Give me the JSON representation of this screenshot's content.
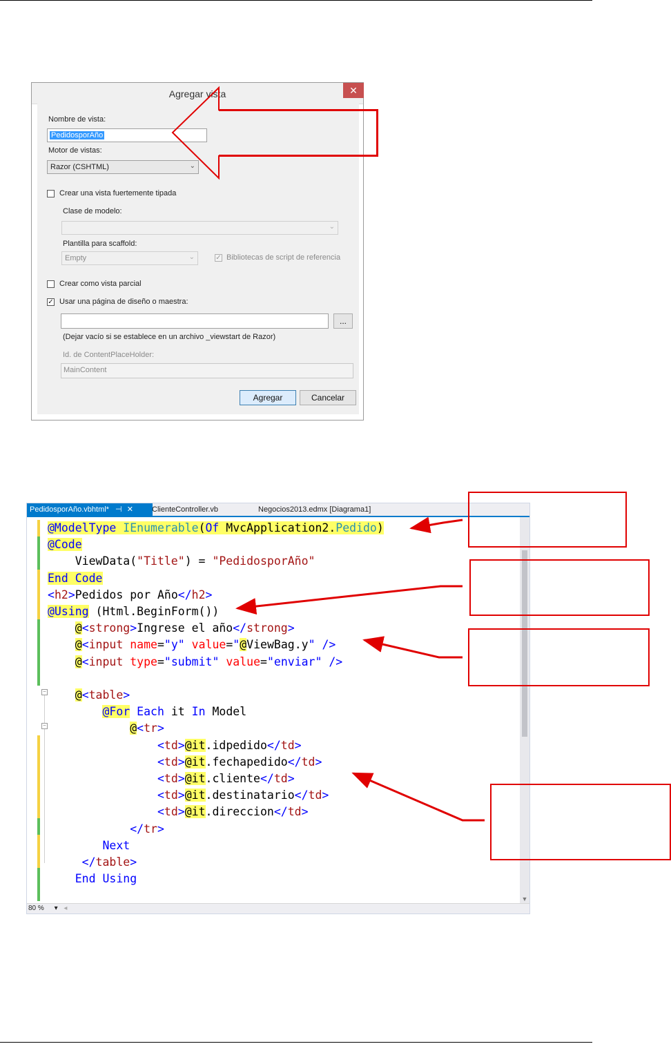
{
  "dialog": {
    "title": "Agregar vista",
    "close_glyph": "✕",
    "view_name_label": "Nombre de vista:",
    "view_name_value": "PedidosporAño",
    "engine_label": "Motor de vistas:",
    "engine_value": "Razor (CSHTML)",
    "strong_typed": {
      "label": "Crear una vista fuertemente tipada",
      "checked": false
    },
    "model_class_label": "Clase de modelo:",
    "model_class_value": "",
    "scaffold_label": "Plantilla para scaffold:",
    "scaffold_value": "Empty",
    "script_libs": {
      "label": "Bibliotecas de script de referencia",
      "checked": true,
      "check_glyph": "✓"
    },
    "partial_view": {
      "label": "Crear como vista parcial",
      "checked": false
    },
    "layout_page": {
      "label": "Usar una página de diseño o maestra:",
      "checked": true,
      "check_glyph": "✓"
    },
    "layout_path_value": "",
    "browse_label": "...",
    "layout_hint": "(Dejar vacío si se establece en un archivo _viewstart de Razor)",
    "placeholder_id_label": "Id. de ContentPlaceHolder:",
    "placeholder_id_value": "MainContent",
    "add_button": "Agregar",
    "cancel_button": "Cancelar"
  },
  "editor": {
    "tabs": [
      {
        "label": "PedidosporAño.vbhtml*",
        "pin": "⊣",
        "close": "✕",
        "active": true
      },
      {
        "label": "ClienteController.vb",
        "active": false
      },
      {
        "label": "Negocios2013.edmx [Diagrama1]",
        "active": false
      }
    ],
    "zoom": "80 %",
    "code_lines": [
      "@ModelType IEnumerable(Of MvcApplication2.Pedido)",
      "@Code",
      "    ViewData(\"Title\") = \"PedidosporAño\"",
      "End Code",
      "<h2>Pedidos por Año</h2>",
      "@Using (Html.BeginForm())",
      "    @<strong>Ingrese el año</strong>",
      "    @<input name=\"y\" value=\"@ViewBag.y\" />",
      "    @<input type=\"submit\" value=\"enviar\" />",
      "",
      "    @<table>",
      "        @For Each it In Model",
      "            @<tr>",
      "                <td>@it.idpedido</td>",
      "                <td>@it.fechapedido</td>",
      "                <td>@it.cliente</td>",
      "                <td>@it.destinatario</td>",
      "                <td>@it.direccion</td>",
      "            </tr>",
      "        Next",
      "     </table>",
      "    End Using"
    ]
  },
  "colors": {
    "accent_blue": "#007acc",
    "annotation_red": "#e00000",
    "razor_highlight": "#ffff66",
    "changed_bar_green": "#5cbf5c",
    "unsaved_bar_yellow": "#f5d142"
  }
}
